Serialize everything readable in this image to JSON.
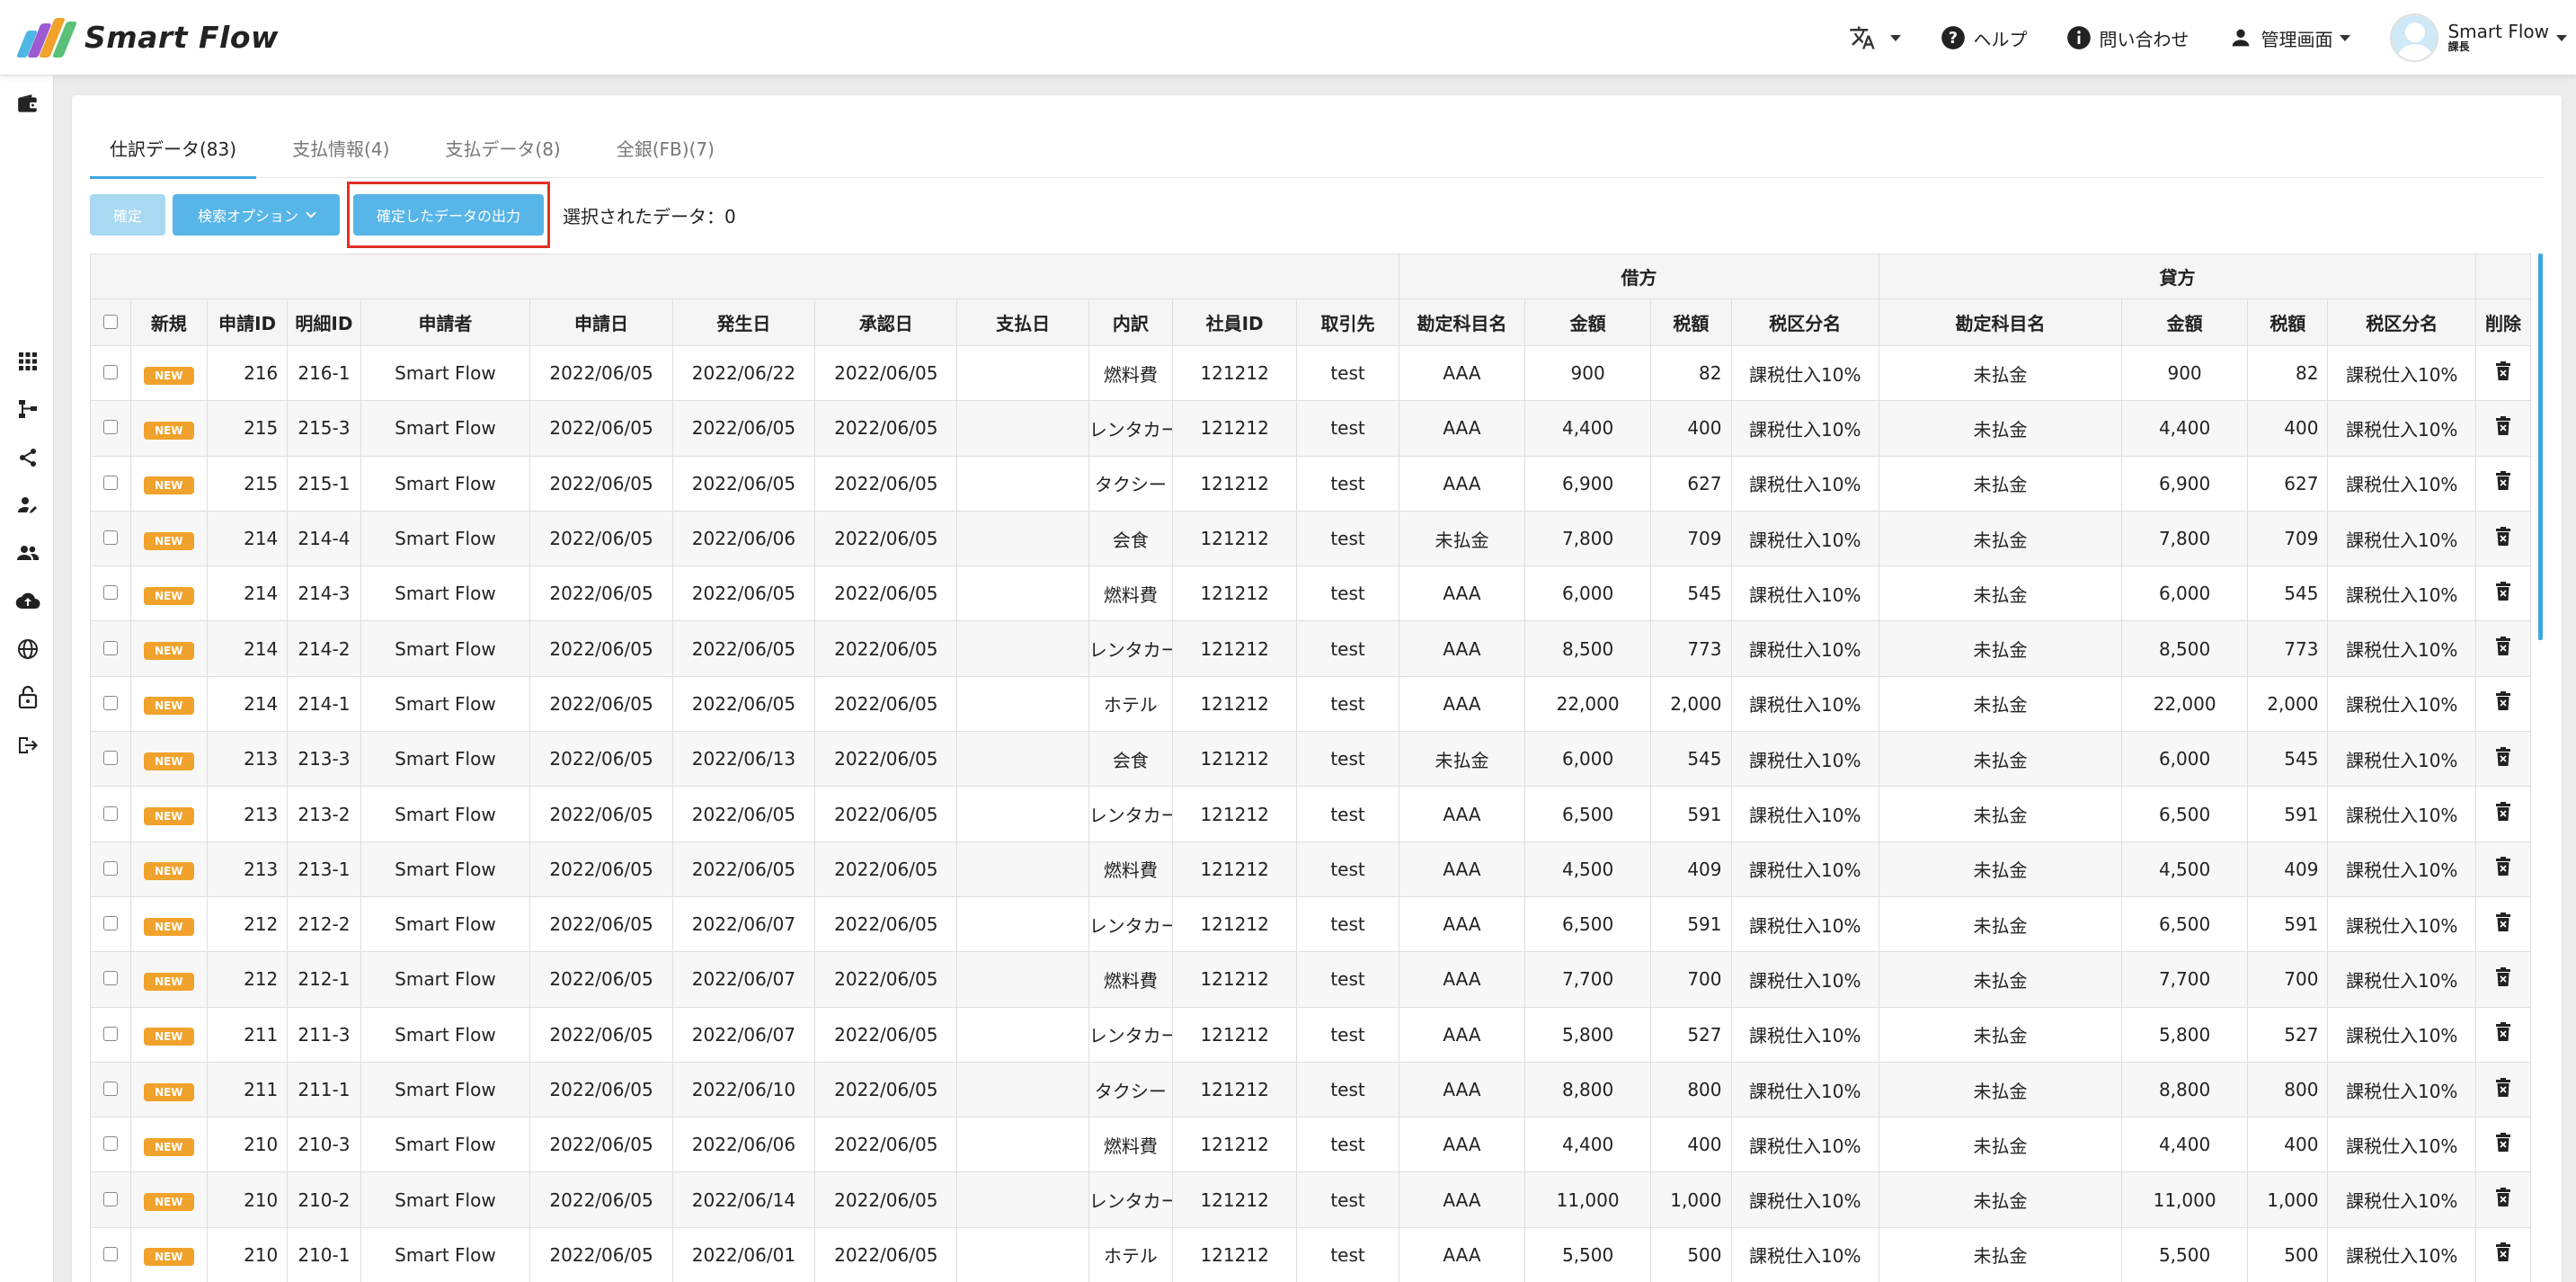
{
  "app": {
    "name": "Smart Flow"
  },
  "header": {
    "translate_icon": "translate-icon",
    "help": "ヘルプ",
    "contact": "問い合わせ",
    "admin": "管理画面",
    "user_name": "Smart Flow",
    "user_role": "課長"
  },
  "tabs": [
    {
      "label": "仕訳データ(83)"
    },
    {
      "label": "支払情報(4)"
    },
    {
      "label": "支払データ(8)"
    },
    {
      "label": "全銀(FB)(7)"
    }
  ],
  "toolbar": {
    "confirm": "確定",
    "search_options": "検索オプション",
    "export": "確定したデータの出力",
    "selected": "選択されたデータ：0"
  },
  "table": {
    "group_debit": "借方",
    "group_credit": "貸方",
    "columns": [
      "新規",
      "申請ID",
      "明細ID",
      "申請者",
      "申請日",
      "発生日",
      "承認日",
      "支払日",
      "内訳",
      "社員ID",
      "取引先",
      "勘定科目名",
      "金額",
      "税額",
      "税区分名",
      "勘定科目名",
      "金額",
      "税額",
      "税区分名",
      "削除"
    ],
    "rows": [
      {
        "new": "NEW",
        "app_id": "216",
        "detail_id": "216-1",
        "applicant": "Smart Flow",
        "applied": "2022/06/05",
        "occurred": "2022/06/22",
        "approved": "2022/06/05",
        "paid": "",
        "item": "燃料費",
        "emp_id": "121212",
        "partner": "test",
        "d_account": "AAA",
        "d_amount": "900",
        "d_tax": "82",
        "d_taxcat": "課税仕入10%",
        "c_account": "未払金",
        "c_amount": "900",
        "c_tax": "82",
        "c_taxcat": "課税仕入10%"
      },
      {
        "new": "NEW",
        "app_id": "215",
        "detail_id": "215-3",
        "applicant": "Smart Flow",
        "applied": "2022/06/05",
        "occurred": "2022/06/05",
        "approved": "2022/06/05",
        "paid": "",
        "item": "レンタカー",
        "emp_id": "121212",
        "partner": "test",
        "d_account": "AAA",
        "d_amount": "4,400",
        "d_tax": "400",
        "d_taxcat": "課税仕入10%",
        "c_account": "未払金",
        "c_amount": "4,400",
        "c_tax": "400",
        "c_taxcat": "課税仕入10%"
      },
      {
        "new": "NEW",
        "app_id": "215",
        "detail_id": "215-1",
        "applicant": "Smart Flow",
        "applied": "2022/06/05",
        "occurred": "2022/06/05",
        "approved": "2022/06/05",
        "paid": "",
        "item": "タクシー",
        "emp_id": "121212",
        "partner": "test",
        "d_account": "AAA",
        "d_amount": "6,900",
        "d_tax": "627",
        "d_taxcat": "課税仕入10%",
        "c_account": "未払金",
        "c_amount": "6,900",
        "c_tax": "627",
        "c_taxcat": "課税仕入10%"
      },
      {
        "new": "NEW",
        "app_id": "214",
        "detail_id": "214-4",
        "applicant": "Smart Flow",
        "applied": "2022/06/05",
        "occurred": "2022/06/06",
        "approved": "2022/06/05",
        "paid": "",
        "item": "会食",
        "emp_id": "121212",
        "partner": "test",
        "d_account": "未払金",
        "d_amount": "7,800",
        "d_tax": "709",
        "d_taxcat": "課税仕入10%",
        "c_account": "未払金",
        "c_amount": "7,800",
        "c_tax": "709",
        "c_taxcat": "課税仕入10%"
      },
      {
        "new": "NEW",
        "app_id": "214",
        "detail_id": "214-3",
        "applicant": "Smart Flow",
        "applied": "2022/06/05",
        "occurred": "2022/06/05",
        "approved": "2022/06/05",
        "paid": "",
        "item": "燃料費",
        "emp_id": "121212",
        "partner": "test",
        "d_account": "AAA",
        "d_amount": "6,000",
        "d_tax": "545",
        "d_taxcat": "課税仕入10%",
        "c_account": "未払金",
        "c_amount": "6,000",
        "c_tax": "545",
        "c_taxcat": "課税仕入10%"
      },
      {
        "new": "NEW",
        "app_id": "214",
        "detail_id": "214-2",
        "applicant": "Smart Flow",
        "applied": "2022/06/05",
        "occurred": "2022/06/05",
        "approved": "2022/06/05",
        "paid": "",
        "item": "レンタカー",
        "emp_id": "121212",
        "partner": "test",
        "d_account": "AAA",
        "d_amount": "8,500",
        "d_tax": "773",
        "d_taxcat": "課税仕入10%",
        "c_account": "未払金",
        "c_amount": "8,500",
        "c_tax": "773",
        "c_taxcat": "課税仕入10%"
      },
      {
        "new": "NEW",
        "app_id": "214",
        "detail_id": "214-1",
        "applicant": "Smart Flow",
        "applied": "2022/06/05",
        "occurred": "2022/06/05",
        "approved": "2022/06/05",
        "paid": "",
        "item": "ホテル",
        "emp_id": "121212",
        "partner": "test",
        "d_account": "AAA",
        "d_amount": "22,000",
        "d_tax": "2,000",
        "d_taxcat": "課税仕入10%",
        "c_account": "未払金",
        "c_amount": "22,000",
        "c_tax": "2,000",
        "c_taxcat": "課税仕入10%"
      },
      {
        "new": "NEW",
        "app_id": "213",
        "detail_id": "213-3",
        "applicant": "Smart Flow",
        "applied": "2022/06/05",
        "occurred": "2022/06/13",
        "approved": "2022/06/05",
        "paid": "",
        "item": "会食",
        "emp_id": "121212",
        "partner": "test",
        "d_account": "未払金",
        "d_amount": "6,000",
        "d_tax": "545",
        "d_taxcat": "課税仕入10%",
        "c_account": "未払金",
        "c_amount": "6,000",
        "c_tax": "545",
        "c_taxcat": "課税仕入10%"
      },
      {
        "new": "NEW",
        "app_id": "213",
        "detail_id": "213-2",
        "applicant": "Smart Flow",
        "applied": "2022/06/05",
        "occurred": "2022/06/05",
        "approved": "2022/06/05",
        "paid": "",
        "item": "レンタカー",
        "emp_id": "121212",
        "partner": "test",
        "d_account": "AAA",
        "d_amount": "6,500",
        "d_tax": "591",
        "d_taxcat": "課税仕入10%",
        "c_account": "未払金",
        "c_amount": "6,500",
        "c_tax": "591",
        "c_taxcat": "課税仕入10%"
      },
      {
        "new": "NEW",
        "app_id": "213",
        "detail_id": "213-1",
        "applicant": "Smart Flow",
        "applied": "2022/06/05",
        "occurred": "2022/06/05",
        "approved": "2022/06/05",
        "paid": "",
        "item": "燃料費",
        "emp_id": "121212",
        "partner": "test",
        "d_account": "AAA",
        "d_amount": "4,500",
        "d_tax": "409",
        "d_taxcat": "課税仕入10%",
        "c_account": "未払金",
        "c_amount": "4,500",
        "c_tax": "409",
        "c_taxcat": "課税仕入10%"
      },
      {
        "new": "NEW",
        "app_id": "212",
        "detail_id": "212-2",
        "applicant": "Smart Flow",
        "applied": "2022/06/05",
        "occurred": "2022/06/07",
        "approved": "2022/06/05",
        "paid": "",
        "item": "レンタカー",
        "emp_id": "121212",
        "partner": "test",
        "d_account": "AAA",
        "d_amount": "6,500",
        "d_tax": "591",
        "d_taxcat": "課税仕入10%",
        "c_account": "未払金",
        "c_amount": "6,500",
        "c_tax": "591",
        "c_taxcat": "課税仕入10%"
      },
      {
        "new": "NEW",
        "app_id": "212",
        "detail_id": "212-1",
        "applicant": "Smart Flow",
        "applied": "2022/06/05",
        "occurred": "2022/06/07",
        "approved": "2022/06/05",
        "paid": "",
        "item": "燃料費",
        "emp_id": "121212",
        "partner": "test",
        "d_account": "AAA",
        "d_amount": "7,700",
        "d_tax": "700",
        "d_taxcat": "課税仕入10%",
        "c_account": "未払金",
        "c_amount": "7,700",
        "c_tax": "700",
        "c_taxcat": "課税仕入10%"
      },
      {
        "new": "NEW",
        "app_id": "211",
        "detail_id": "211-3",
        "applicant": "Smart Flow",
        "applied": "2022/06/05",
        "occurred": "2022/06/07",
        "approved": "2022/06/05",
        "paid": "",
        "item": "レンタカー",
        "emp_id": "121212",
        "partner": "test",
        "d_account": "AAA",
        "d_amount": "5,800",
        "d_tax": "527",
        "d_taxcat": "課税仕入10%",
        "c_account": "未払金",
        "c_amount": "5,800",
        "c_tax": "527",
        "c_taxcat": "課税仕入10%"
      },
      {
        "new": "NEW",
        "app_id": "211",
        "detail_id": "211-1",
        "applicant": "Smart Flow",
        "applied": "2022/06/05",
        "occurred": "2022/06/10",
        "approved": "2022/06/05",
        "paid": "",
        "item": "タクシー",
        "emp_id": "121212",
        "partner": "test",
        "d_account": "AAA",
        "d_amount": "8,800",
        "d_tax": "800",
        "d_taxcat": "課税仕入10%",
        "c_account": "未払金",
        "c_amount": "8,800",
        "c_tax": "800",
        "c_taxcat": "課税仕入10%"
      },
      {
        "new": "NEW",
        "app_id": "210",
        "detail_id": "210-3",
        "applicant": "Smart Flow",
        "applied": "2022/06/05",
        "occurred": "2022/06/06",
        "approved": "2022/06/05",
        "paid": "",
        "item": "燃料費",
        "emp_id": "121212",
        "partner": "test",
        "d_account": "AAA",
        "d_amount": "4,400",
        "d_tax": "400",
        "d_taxcat": "課税仕入10%",
        "c_account": "未払金",
        "c_amount": "4,400",
        "c_tax": "400",
        "c_taxcat": "課税仕入10%"
      },
      {
        "new": "NEW",
        "app_id": "210",
        "detail_id": "210-2",
        "applicant": "Smart Flow",
        "applied": "2022/06/05",
        "occurred": "2022/06/14",
        "approved": "2022/06/05",
        "paid": "",
        "item": "レンタカー",
        "emp_id": "121212",
        "partner": "test",
        "d_account": "AAA",
        "d_amount": "11,000",
        "d_tax": "1,000",
        "d_taxcat": "課税仕入10%",
        "c_account": "未払金",
        "c_amount": "11,000",
        "c_tax": "1,000",
        "c_taxcat": "課税仕入10%"
      },
      {
        "new": "NEW",
        "app_id": "210",
        "detail_id": "210-1",
        "applicant": "Smart Flow",
        "applied": "2022/06/05",
        "occurred": "2022/06/01",
        "approved": "2022/06/05",
        "paid": "",
        "item": "ホテル",
        "emp_id": "121212",
        "partner": "test",
        "d_account": "AAA",
        "d_amount": "5,500",
        "d_tax": "500",
        "d_taxcat": "課税仕入10%",
        "c_account": "未払金",
        "c_amount": "5,500",
        "c_tax": "500",
        "c_taxcat": "課税仕入10%"
      }
    ]
  },
  "colors": {
    "accent": "#3ea6e0",
    "button": "#57b5e8",
    "button_disabled": "#a9d8f1",
    "badge": "#f0a22c",
    "highlight": "#e03024"
  }
}
